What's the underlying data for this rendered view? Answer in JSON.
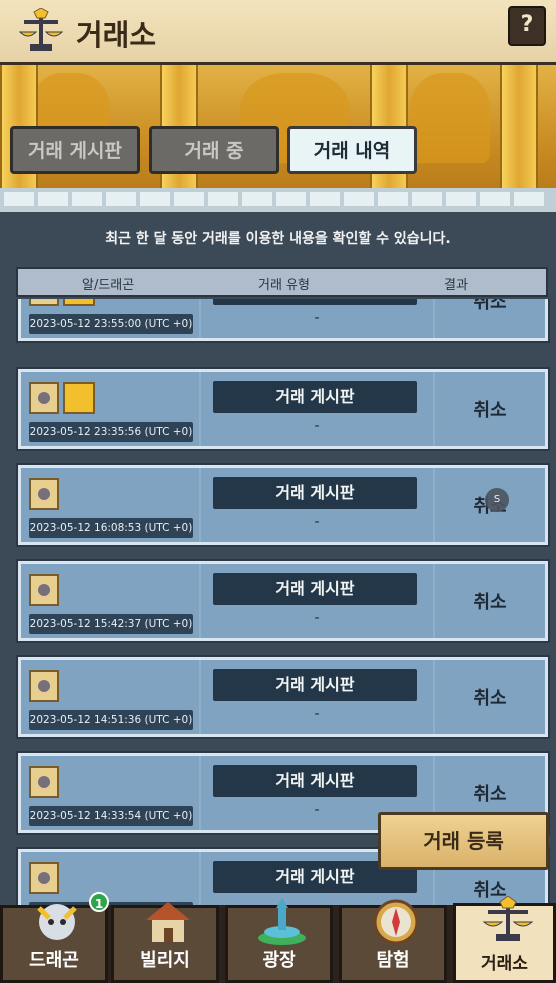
{
  "header": {
    "title": "거래소",
    "help_label": "?"
  },
  "tabs": [
    {
      "label": "거래 게시판",
      "active": false
    },
    {
      "label": "거래 중",
      "active": false
    },
    {
      "label": "거래 내역",
      "active": true
    }
  ],
  "notice": "최근 한 달 동안 거래를 이용한 내용을 확인할 수 있습니다.",
  "columns": {
    "egg_dragon": "알/드래곤",
    "trade_type": "거래 유형",
    "result": "결과"
  },
  "rows": [
    {
      "datetime": "2023-05-12 23:55:00 (UTC +0)",
      "type": "거래 게시판",
      "detail": "-",
      "result": "취소"
    },
    {
      "datetime": "2023-05-12 23:35:56 (UTC +0)",
      "type": "거래 게시판",
      "detail": "-",
      "result": "취소"
    },
    {
      "datetime": "2023-05-12 16:08:53 (UTC +0)",
      "type": "거래 게시판",
      "detail": "-",
      "result": "취소"
    },
    {
      "datetime": "2023-05-12 15:42:37 (UTC +0)",
      "type": "거래 게시판",
      "detail": "-",
      "result": "취소"
    },
    {
      "datetime": "2023-05-12 14:51:36 (UTC +0)",
      "type": "거래 게시판",
      "detail": "-",
      "result": "취소"
    },
    {
      "datetime": "2023-05-12 14:33:54 (UTC +0)",
      "type": "거래 게시판",
      "detail": "-",
      "result": "취소"
    },
    {
      "datetime": "",
      "type": "거래 게시판",
      "detail": "-",
      "result": "취소"
    }
  ],
  "register_button": "거래 등록",
  "touch_indicator": "S",
  "nav": [
    {
      "label": "드래곤",
      "badge": "1"
    },
    {
      "label": "빌리지"
    },
    {
      "label": "광장"
    },
    {
      "label": "탐험"
    },
    {
      "label": "거래소",
      "active": true
    }
  ]
}
